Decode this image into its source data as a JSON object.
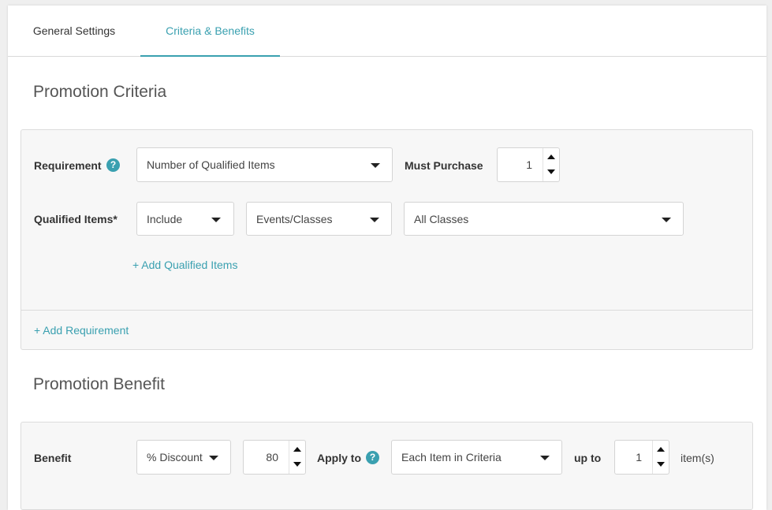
{
  "tabs": {
    "general": "General Settings",
    "criteria": "Criteria & Benefits"
  },
  "criteria": {
    "title": "Promotion Criteria",
    "requirement_label": "Requirement",
    "help_glyph": "?",
    "requirement_value": "Number of Qualified Items",
    "must_purchase_label": "Must Purchase",
    "must_purchase_value": "1",
    "qualified_items_label": "Qualified Items*",
    "include_value": "Include",
    "category_value": "Events/Classes",
    "classes_value": "All Classes",
    "add_qualified_items": "+ Add Qualified Items",
    "add_requirement": "+ Add Requirement"
  },
  "benefit": {
    "title": "Promotion Benefit",
    "benefit_label": "Benefit",
    "discount_type": "% Discount",
    "discount_value": "80",
    "apply_to_label": "Apply to",
    "apply_to_value": "Each Item in Criteria",
    "up_to_label": "up to",
    "up_to_value": "1",
    "unit_text": "item(s)"
  },
  "colors": {
    "accent": "#3aa0b0",
    "panel_bg": "#f7f7f7",
    "page_bg": "#efefef"
  },
  "icons": {
    "help": "help-circle-icon",
    "caret": "caret-down-icon",
    "step_up": "triangle-up-icon",
    "step_down": "triangle-down-icon"
  }
}
